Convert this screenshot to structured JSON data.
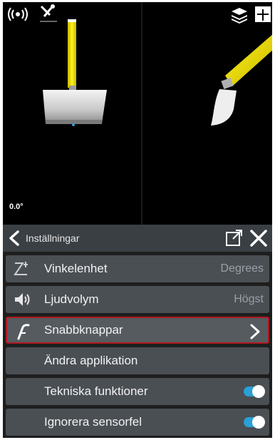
{
  "viewport": {
    "angle_readout": "0.0°"
  },
  "header": {
    "title": "Inställningar"
  },
  "settings": {
    "items": [
      {
        "label": "Vinkelenhet",
        "value": "Degrees",
        "icon": "angle-unit-icon"
      },
      {
        "label": "Ljudvolym",
        "value": "Högst",
        "icon": "speaker-icon"
      },
      {
        "label": "Snabbknappar",
        "icon": "quick-buttons-icon",
        "selected": true
      },
      {
        "label": "Ändra applikation"
      },
      {
        "label": "Tekniska funktioner",
        "toggle": true
      },
      {
        "label": "Ignorera sensorfel",
        "toggle": true
      }
    ]
  },
  "colors": {
    "accent_toggle": "#2aa0d6",
    "highlight_border": "#b01820",
    "boom_yellow": "#f5e400"
  }
}
